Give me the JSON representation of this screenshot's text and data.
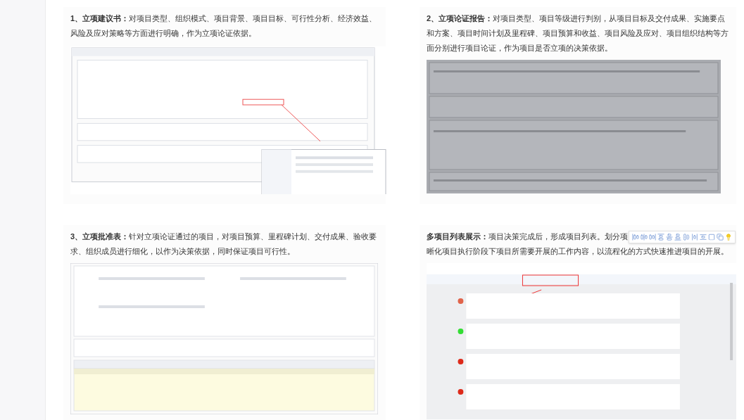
{
  "sections": [
    {
      "kind": "plain",
      "title": "1、立项建议书：",
      "text": "对项目类型、组织模式、项目背景、项目目标、可行性分析、经济效益、风险及应对策略等方面进行明确，作为立项论证依据。"
    },
    {
      "kind": "plain",
      "title": "2、立项论证报告：",
      "text": "对项目类型、项目等级进行判别，从项目目标及交付成果、实施要点和方案、项目时间计划及里程碑、项目预算和收益、项目风险及应对、项目组织结构等方面分别进行项目论证，作为项目是否立项的决策依据。"
    },
    {
      "kind": "plain",
      "title": "3、立项批准表：",
      "text": "针对立项论证通过的项目，对项目预算、里程碑计划、交付成果、验收要求、组织成员进行细化，以作为决策依据，同时保证项目可行性。"
    },
    {
      "kind": "covered",
      "title": "多项目列表展示：",
      "text": "项目决策完成后，形成项目列表。划分项",
      "continuation": "晰化项目执行阶段下项目所需要开展的工作内容，以流程化的方式快速推进项目的开展。"
    }
  ]
}
